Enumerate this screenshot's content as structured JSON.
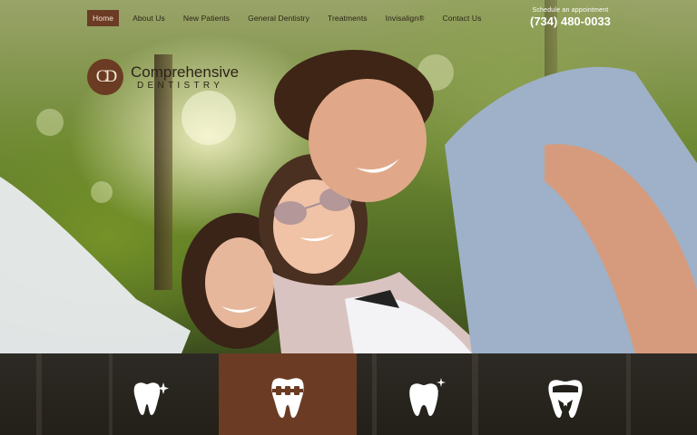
{
  "nav": {
    "items": [
      {
        "label": "Home",
        "active": true
      },
      {
        "label": "About Us"
      },
      {
        "label": "New Patients"
      },
      {
        "label": "General Dentistry"
      },
      {
        "label": "Treatments"
      },
      {
        "label": "Invisalign®"
      },
      {
        "label": "Contact Us"
      }
    ]
  },
  "appointment": {
    "label": "Schedule an appointment",
    "phone": "(734) 480-0033"
  },
  "logo": {
    "monogram": "CD",
    "line1": "Comprehensive",
    "line2": "DENTISTRY"
  },
  "services": [
    {
      "icon": "sparkling-tooth-icon",
      "active": false
    },
    {
      "icon": "braces-tooth-icon",
      "active": true
    },
    {
      "icon": "whitening-tooth-icon",
      "active": false
    },
    {
      "icon": "crown-tooth-icon",
      "active": false
    }
  ],
  "colors": {
    "brand": "#6b3b23",
    "bar": "#2a2722"
  }
}
